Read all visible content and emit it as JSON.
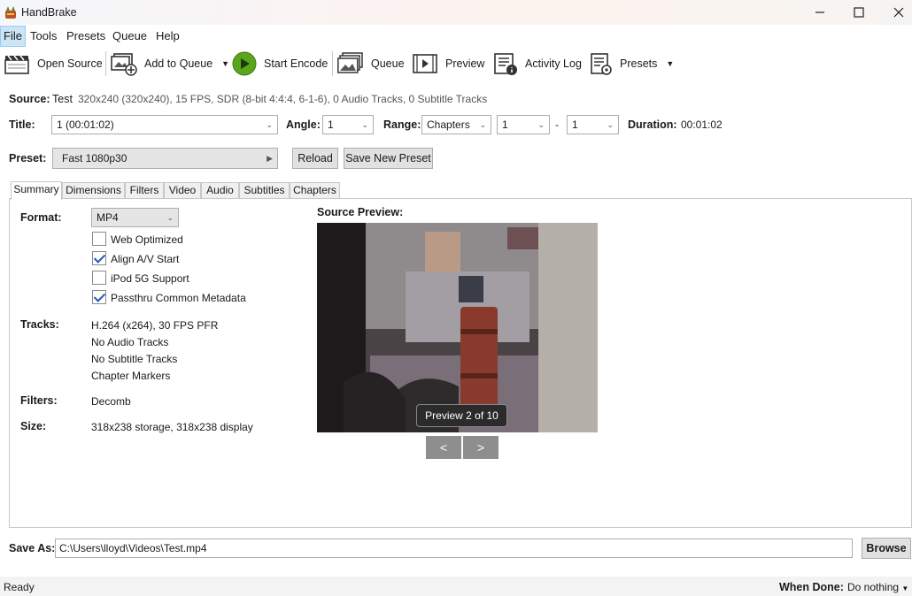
{
  "window": {
    "title": "HandBrake"
  },
  "menu": [
    "File",
    "Tools",
    "Presets",
    "Queue",
    "Help"
  ],
  "toolbar": {
    "open_source": "Open Source",
    "add_to_queue": "Add to Queue",
    "start_encode": "Start Encode",
    "queue": "Queue",
    "preview": "Preview",
    "activity_log": "Activity Log",
    "presets": "Presets"
  },
  "source": {
    "label": "Source:",
    "name": "Test",
    "info": "320x240 (320x240), 15 FPS, SDR (8-bit 4:4:4, 6-1-6), 0 Audio Tracks, 0 Subtitle Tracks"
  },
  "title_row": {
    "title_label": "Title:",
    "title_value": "1 (00:01:02)",
    "angle_label": "Angle:",
    "angle_value": "1",
    "range_label": "Range:",
    "range_type": "Chapters",
    "range_start": "1",
    "range_dash": "-",
    "range_end": "1",
    "duration_label": "Duration:",
    "duration_value": "00:01:02"
  },
  "preset_row": {
    "label": "Preset:",
    "value": "Fast 1080p30",
    "reload": "Reload",
    "save_new": "Save New Preset"
  },
  "tabs": [
    "Summary",
    "Dimensions",
    "Filters",
    "Video",
    "Audio",
    "Subtitles",
    "Chapters"
  ],
  "summary": {
    "format_label": "Format:",
    "format_value": "MP4",
    "options": [
      {
        "label": "Web Optimized",
        "checked": false
      },
      {
        "label": "Align A/V Start",
        "checked": true
      },
      {
        "label": "iPod 5G Support",
        "checked": false
      },
      {
        "label": "Passthru Common Metadata",
        "checked": true
      }
    ],
    "tracks_label": "Tracks:",
    "tracks": [
      "H.264 (x264), 30 FPS PFR",
      "No Audio Tracks",
      "No Subtitle Tracks",
      "Chapter Markers"
    ],
    "filters_label": "Filters:",
    "filters_value": "Decomb",
    "size_label": "Size:",
    "size_value": "318x238 storage, 318x238 display",
    "preview_label": "Source Preview:",
    "preview_badge": "Preview 2 of 10",
    "prev": "<",
    "next": ">"
  },
  "save_as": {
    "label": "Save As:",
    "path": "C:\\Users\\lloyd\\Videos\\Test.mp4",
    "browse": "Browse"
  },
  "status": {
    "text": "Ready",
    "when_done_label": "When Done:",
    "when_done_value": "Do nothing"
  },
  "colors": {
    "accent": "#cce4f7",
    "play_green": "#5aa51e",
    "check_blue": "#1a5fb4"
  }
}
